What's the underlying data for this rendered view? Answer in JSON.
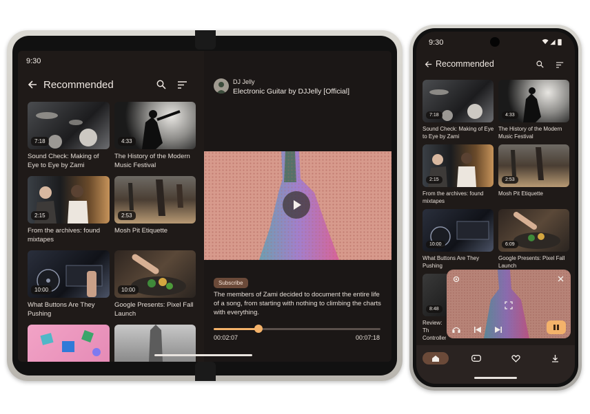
{
  "foldable": {
    "status": {
      "time": "9:30"
    },
    "header": {
      "title": "Recommended"
    },
    "videos": [
      {
        "title": "Sound Check: Making of Eye to Eye by Zami",
        "duration": "7:18"
      },
      {
        "title": "The History of the Modern Music Festival",
        "duration": "4:33"
      },
      {
        "title": "From the archives: found mixtapes",
        "duration": "2:15"
      },
      {
        "title": "Mosh Pit Etiquette",
        "duration": "2:53"
      },
      {
        "title": "What Buttons Are They Pushing",
        "duration": "10:00"
      },
      {
        "title": "Google Presents: Pixel Fall Launch",
        "duration": "10:00"
      }
    ],
    "detail": {
      "channel": "DJ Jelly",
      "video_title": "Electronic Guitar by DJJelly [Official]",
      "subscribe": "Subscribe",
      "description": "The members of Zami decided to document the entire life of a song, from starting with nothing to climbing the charts with everything.",
      "elapsed": "00:02:07",
      "total": "00:07:18",
      "progress": 0.27
    }
  },
  "phone": {
    "status": {
      "time": "9:30"
    },
    "header": {
      "title": "Recommended"
    },
    "videos": [
      {
        "title": "Sound Check: Making of Eye to Eye by Zami",
        "duration": "7:18"
      },
      {
        "title": "The History of the Modern Music Festival",
        "duration": "4:33"
      },
      {
        "title": "From the archives: found mixtapes",
        "duration": "2:15"
      },
      {
        "title": "Mosh Pit Etiquette",
        "duration": "2:53"
      },
      {
        "title": "What Buttons Are They Pushing",
        "duration": "10:00"
      },
      {
        "title": "Google Presents: Pixel Fall Launch",
        "duration": "6:09"
      },
      {
        "title": "Review: Th Controller",
        "duration": "8:48"
      }
    ],
    "nav": [
      "home-icon",
      "gamepad-icon",
      "heart-icon",
      "download-icon"
    ]
  },
  "colors": {
    "accent": "#f4b26a",
    "chip": "#6b4a39",
    "surface": "#1f1a18"
  }
}
